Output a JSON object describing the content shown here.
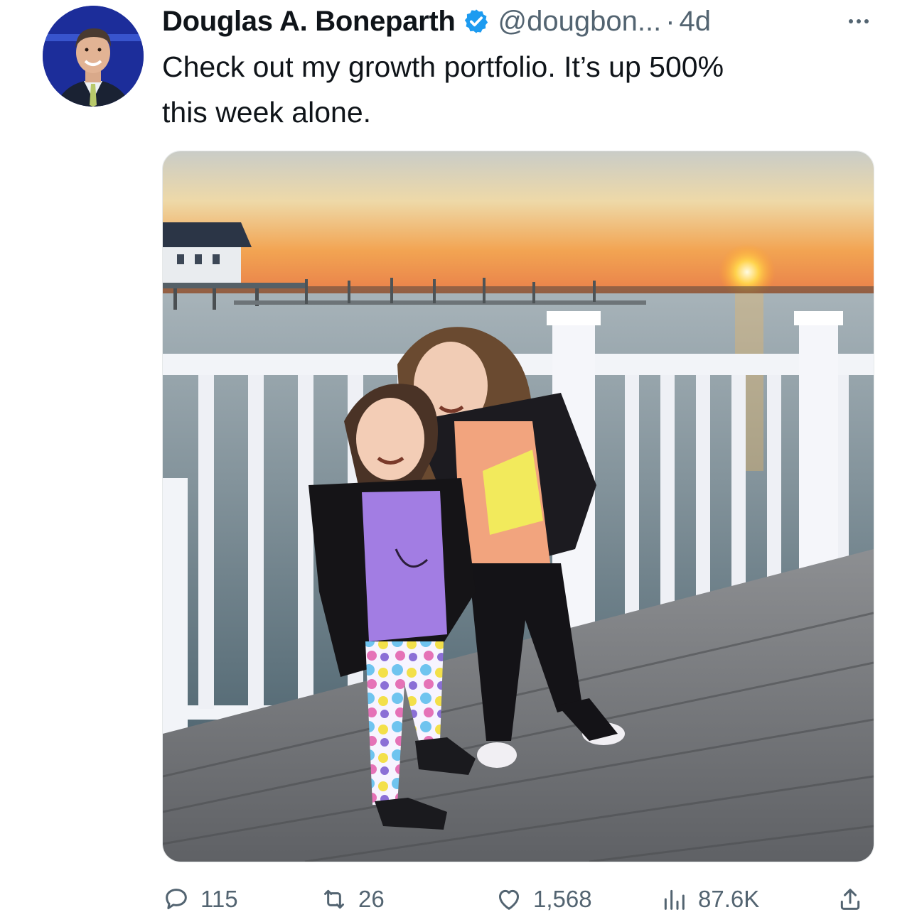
{
  "tweet": {
    "author_name": "Douglas A. Boneparth",
    "handle": "@dougbon...",
    "separator": "·",
    "time": "4d",
    "text_line1": "Check out my growth portfolio. It’s up 500%",
    "text_line2": "this week alone."
  },
  "actions": {
    "replies": "115",
    "retweets": "26",
    "likes": "1,568",
    "views": "87.6K"
  },
  "icons": {
    "verified": "verified-badge-icon",
    "more": "more-options-icon",
    "reply": "reply-icon",
    "retweet": "retweet-icon",
    "like": "heart-icon",
    "views": "views-icon",
    "share": "share-icon"
  },
  "colors": {
    "verified_blue": "#1d9bf0",
    "secondary_text": "#536471",
    "primary_text": "#0f1419"
  }
}
